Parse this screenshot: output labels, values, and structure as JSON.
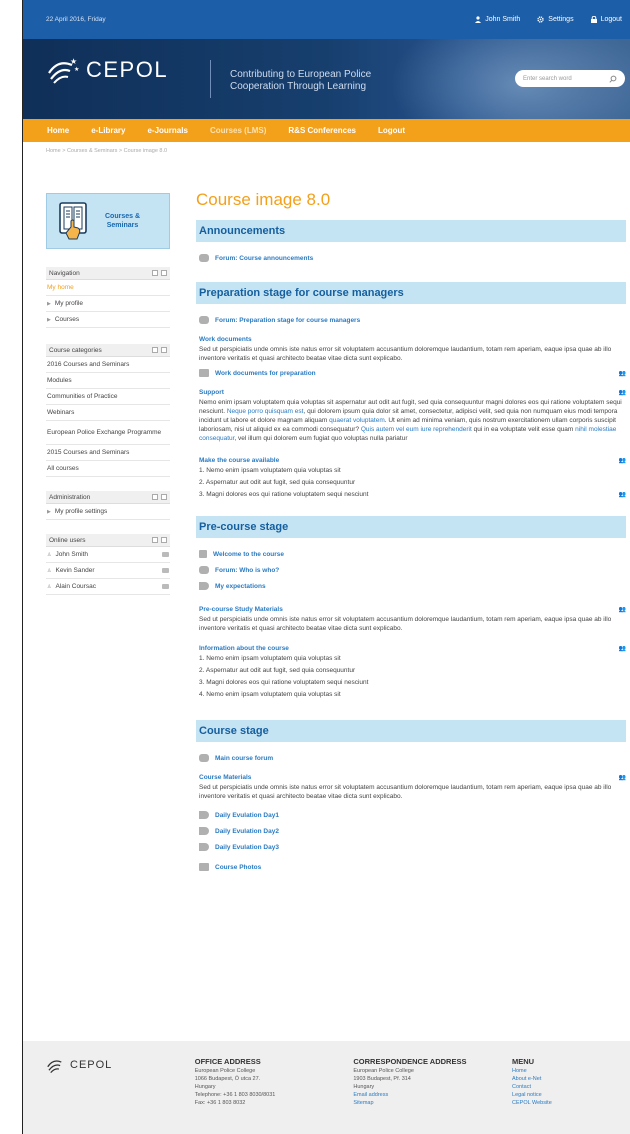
{
  "topbar": {
    "date": "22 April 2016, Friday",
    "user": "John Smith",
    "settings": "Settings",
    "logout": "Logout"
  },
  "header": {
    "logo": "CEPOL",
    "tagline_1": "Contributing to European Police",
    "tagline_2": "Cooperation Through Learning",
    "search_placeholder": "Enter search word"
  },
  "nav": [
    "Home",
    "e-Library",
    "e-Journals",
    "Courses (LMS)",
    "R&S Conferences",
    "Logout"
  ],
  "breadcrumb": "Home > Courses & Seminars > Course image 8.0",
  "promo": {
    "line1": "Courses &",
    "line2": "Seminars"
  },
  "navigation": {
    "title": "Navigation",
    "items": [
      "My home",
      "My profile",
      "Courses"
    ]
  },
  "categories": {
    "title": "Course categories",
    "items": [
      "2016 Courses and Seminars",
      "Modules",
      "Communities of Practice",
      "Webinars",
      "European Police Exchange Programme",
      "2015 Courses and Seminars",
      "All courses"
    ]
  },
  "administration": {
    "title": "Administration",
    "items": [
      "My profile settings"
    ]
  },
  "online": {
    "title": "Online users",
    "users": [
      "John Smith",
      "Kevin Sander",
      "Alain Coursac"
    ]
  },
  "main": {
    "title": "Course image 8.0",
    "s1": {
      "head": "Announcements",
      "forum": "Forum: Course announcements"
    },
    "s2": {
      "head": "Preparation stage for course managers",
      "forum": "Forum: Preparation stage for course managers",
      "wd_title": "Work documents",
      "wd_text": "Sed ut perspiciatis unde omnis iste natus error sit voluptatem accusantium doloremque laudantium, totam rem aperiam, eaque ipsa quae ab illo inventore veritatis et quasi architecto beatae vitae dicta sunt explicabo.",
      "wd_link": "Work documents for preparation",
      "sup_title": "Support",
      "sup_a": "Nemo enim ipsam voluptatem quia voluptas sit aspernatur aut odit aut fugit, sed quia consequuntur magni dolores eos qui ratione voluptatem sequi nesciunt.",
      "sup_l1": "Neque porro quisquam est",
      "sup_b": ", qui dolorem ipsum quia dolor sit amet, consectetur, adipisci velit, sed quia non numquam eius modi tempora incidunt ut labore et dolore magnam aliquam",
      "sup_l2": "quaerat voluptatem",
      "sup_c": ". Ut enim ad minima veniam, quis nostrum exercitationem ullam corporis suscipit laboriosam, nisi ut aliquid ex ea commodi consequatur?",
      "sup_l3": "Quis autem vel eum iure reprehenderit",
      "sup_d": "qui in ea voluptate velit esse quam",
      "sup_l4": "nihil molestiae consequatur",
      "sup_e": ", vel illum qui dolorem eum fugiat quo voluptas nulla pariatur",
      "mk_title": "Make the course available",
      "mk_items": [
        "1. Nemo enim ipsam voluptatem quia voluptas sit",
        "2. Aspernatur aut odit aut fugit, sed quia consequuntur",
        "3. Magni dolores eos qui ratione voluptatem sequi nesciunt"
      ]
    },
    "s3": {
      "head": "Pre-course stage",
      "links": [
        "Welcome to the course",
        "Forum: Who is who?",
        "My expectations"
      ],
      "pm_title": "Pre-course Study Materials",
      "pm_text": "Sed ut perspiciatis unde omnis iste natus error sit voluptatem accusantium doloremque laudantium, totam rem aperiam, eaque ipsa quae ab illo inventore veritatis et quasi architecto beatae vitae dicta sunt explicabo.",
      "info_title": "Information about the course",
      "info_items": [
        "1. Nemo enim ipsam voluptatem quia voluptas sit",
        "2. Aspernatur aut odit aut fugit, sed quia consequuntur",
        "3. Magni dolores eos qui ratione voluptatem sequi nesciunt",
        "4. Nemo enim ipsam voluptatem quia voluptas sit"
      ]
    },
    "s4": {
      "head": "Course stage",
      "forum": "Main course forum",
      "cm_title": "Course Materials",
      "cm_text": "Sed ut perspiciatis unde omnis iste natus error sit voluptatem accusantium doloremque laudantium, totam rem aperiam, eaque ipsa quae ab illo inventore veritatis et quasi architecto beatae vitae dicta sunt explicabo.",
      "links": [
        "Daily Evulation Day1",
        "Daily Evulation Day2",
        "Daily Evulation Day3"
      ],
      "photos": "Course Photos"
    }
  },
  "footer": {
    "logo": "CEPOL",
    "office": {
      "title": "OFFICE ADDRESS",
      "lines": [
        "European Police College",
        "1066 Budapest, Ó utca 27.",
        "Hungary",
        "Telephone: +36 1 803 8030/8031",
        "Fax: +36 1 803 8032"
      ]
    },
    "corr": {
      "title": "CORRESPONDENCE ADDRESS",
      "lines": [
        "European Police College",
        "1903 Budapest, Pf. 314",
        "Hungary"
      ],
      "email": "Email address",
      "sitemap": "Sitemap"
    },
    "menu": {
      "title": "MENU",
      "items": [
        "Home",
        "About e-Net",
        "Contact",
        "Legal notice",
        "CEPOL Website"
      ]
    }
  },
  "colors": {
    "brand_blue": "#1d5ea8",
    "nav_orange": "#f3a01b",
    "section_bg": "#c4e3f3",
    "link": "#2a7bc2"
  },
  "icons": [
    "user-icon",
    "gear-icon",
    "lock-icon",
    "search-icon",
    "forum-icon",
    "folder-icon",
    "people-icon",
    "page-icon",
    "megaphone-icon"
  ]
}
